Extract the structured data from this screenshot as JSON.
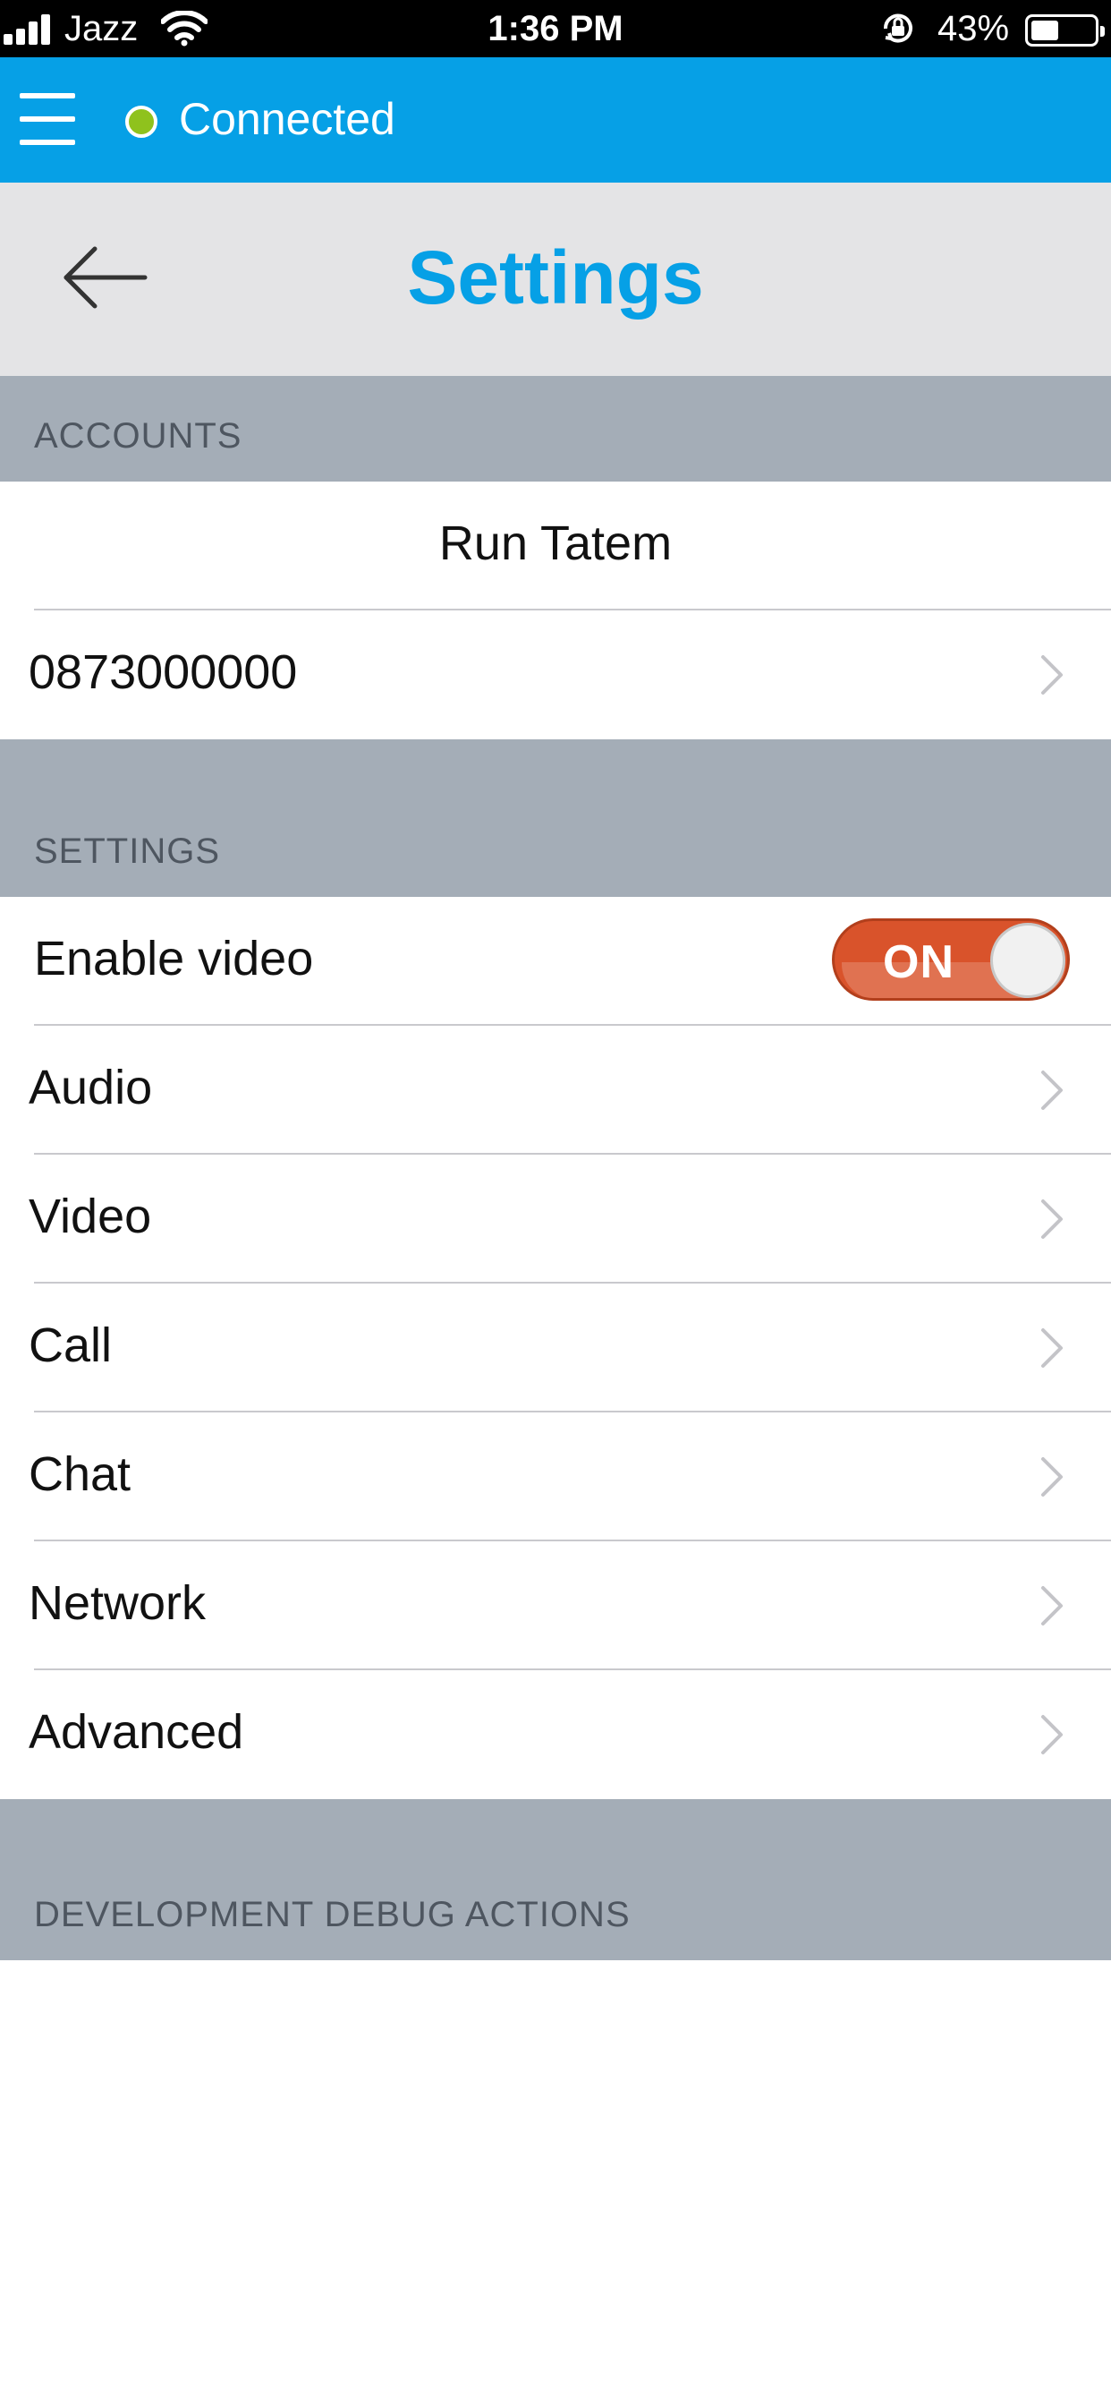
{
  "status_bar": {
    "carrier": "Jazz",
    "time": "1:36 PM",
    "battery_percent": "43%",
    "battery_level": 0.43,
    "icons": [
      "signal-icon",
      "wifi-icon",
      "rotation-lock-icon",
      "battery-icon"
    ]
  },
  "app_bar": {
    "connection_status": "Connected",
    "status_color": "#8fc21d",
    "bar_color": "#06a0e6",
    "menu_icon": "hamburger-menu-icon"
  },
  "header": {
    "title": "Settings",
    "back_icon": "back-arrow-icon"
  },
  "accounts_section": {
    "header": "ACCOUNTS",
    "account_name": "Run Tatem",
    "account_number": "0873000000"
  },
  "settings_section": {
    "header": "SETTINGS",
    "enable_video": {
      "label": "Enable video",
      "toggle_text": "ON",
      "value": true,
      "toggle_color": "#d9532b"
    },
    "items": [
      {
        "label": "Audio"
      },
      {
        "label": "Video"
      },
      {
        "label": "Call"
      },
      {
        "label": "Chat"
      },
      {
        "label": "Network"
      },
      {
        "label": "Advanced"
      }
    ]
  },
  "debug_section": {
    "header": "DEVELOPMENT DEBUG ACTIONS"
  }
}
